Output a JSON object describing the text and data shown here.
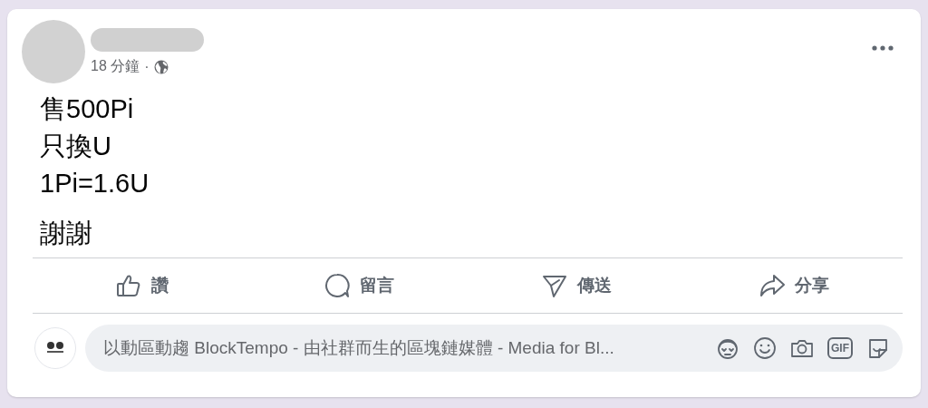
{
  "post": {
    "time": "18 分鐘",
    "separator": "·",
    "paragraphs": [
      {
        "lines": [
          "售500Pi",
          "只換U",
          "1Pi=1.6U"
        ]
      },
      {
        "lines": [
          "謝謝"
        ]
      }
    ],
    "actions": [
      {
        "kind": "like",
        "label": "讚"
      },
      {
        "kind": "comment",
        "label": "留言"
      },
      {
        "kind": "send",
        "label": "傳送"
      },
      {
        "kind": "share",
        "label": "分享"
      }
    ],
    "comment_box": {
      "placeholder": "以動區動趨 BlockTempo - 由社群而生的區塊鏈媒體 - Media for Bl...",
      "tools": [
        {
          "kind": "avatar"
        },
        {
          "kind": "emoji"
        },
        {
          "kind": "camera"
        },
        {
          "kind": "gif",
          "label": "GIF"
        },
        {
          "kind": "sticker"
        }
      ]
    }
  }
}
